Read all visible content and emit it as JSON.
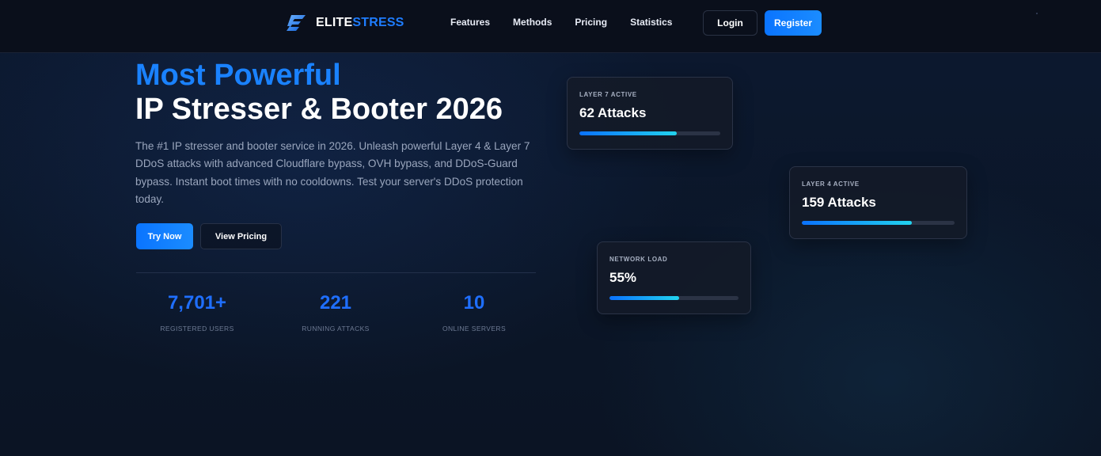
{
  "brand": {
    "name_part1": "ELITE",
    "name_part2": "STRESS",
    "logo_icon": "lightning-e-logo",
    "accent_color": "#1f7dff"
  },
  "nav": {
    "links": [
      "Features",
      "Methods",
      "Pricing",
      "Statistics"
    ],
    "login_label": "Login",
    "register_label": "Register"
  },
  "hero": {
    "title_line1": "Most Powerful",
    "title_line2": "IP Stresser & Booter 2026",
    "description": "The #1 IP stresser and booter service in 2026. Unleash powerful Layer 4 & Layer 7 DDoS attacks with advanced Cloudflare bypass, OVH bypass, and DDoS-Guard bypass. Instant boot times with no cooldowns. Test your server's DDoS protection today.",
    "primary_button": "Try Now",
    "secondary_button": "View Pricing"
  },
  "stats": [
    {
      "value": "7,701+",
      "label": "REGISTERED USERS"
    },
    {
      "value": "221",
      "label": "RUNNING ATTACKS"
    },
    {
      "value": "10",
      "label": "ONLINE SERVERS"
    }
  ],
  "cards": [
    {
      "label": "LAYER 7 ACTIVE",
      "value": "62 Attacks",
      "progress": 0.69
    },
    {
      "label": "LAYER 4 ACTIVE",
      "value": "159 Attacks",
      "progress": 0.72
    },
    {
      "label": "NETWORK LOAD",
      "value": "55%",
      "progress": 0.54
    }
  ]
}
